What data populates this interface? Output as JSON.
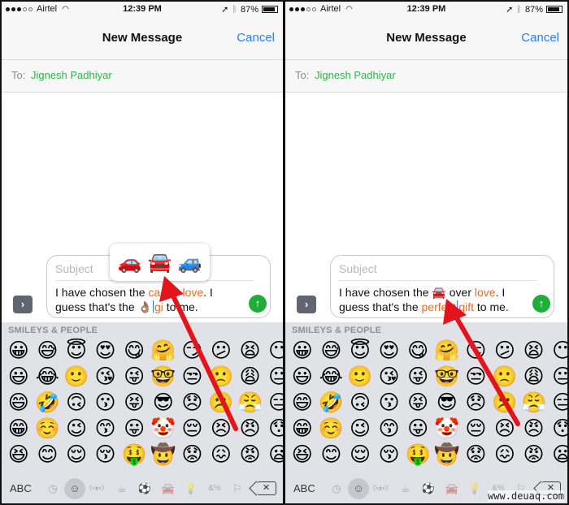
{
  "panels": [
    {
      "status": {
        "carrier": "Airtel",
        "time": "12:39 PM",
        "battery": "87%",
        "battery_level": 0.87
      },
      "nav": {
        "title": "New Message",
        "cancel": "Cancel"
      },
      "to": {
        "label": "To:",
        "recipient": "Jignesh Padhiyar"
      },
      "compose": {
        "subject_placeholder": "Subject",
        "line1": [
          "I have chosen the ",
          {
            "hl": "ca"
          },
          " ",
          "ver ",
          {
            "hl": "love"
          },
          ". I"
        ],
        "text_line1_a": "I have chosen the ",
        "text_line1_hl1": "ca",
        "text_line1_b": "ver ",
        "text_line1_hl2": "love",
        "text_line1_c": ". I",
        "text_line2_a": "guess that's the ",
        "text_line2_emoji": "👌🏽",
        "text_line2_hl": "gi",
        "text_line2_b": " to me."
      },
      "popup": {
        "options": [
          "🚗",
          "🚘",
          "🚙"
        ]
      }
    },
    {
      "status": {
        "carrier": "Airtel",
        "time": "12:39 PM",
        "battery": "87%",
        "battery_level": 0.87
      },
      "nav": {
        "title": "New Message",
        "cancel": "Cancel"
      },
      "to": {
        "label": "To:",
        "recipient": "Jignesh Padhiyar"
      },
      "compose": {
        "subject_placeholder": "Subject",
        "text_line1_a": "I have chosen the ",
        "text_line1_emoji": "🚘",
        "text_line1_b": " over ",
        "text_line1_hl": "love",
        "text_line1_c": ". I",
        "text_line2_a": "guess that's the ",
        "text_line2_hl1": "perfect",
        "text_line2_hl2": "gift",
        "text_line2_b": " to me."
      }
    }
  ],
  "keyboard": {
    "category_label": "SMILEYS & PEOPLE",
    "rows": [
      [
        "😀",
        "😅",
        "😇",
        "😍",
        "😋",
        "🤗",
        "😏",
        "😕",
        "😫",
        "😶"
      ],
      [
        "😃",
        "😂",
        "🙂",
        "😘",
        "😜",
        "🤓",
        "😒",
        "🙁",
        "😩",
        "😐"
      ],
      [
        "😄",
        "🤣",
        "🙃",
        "😗",
        "😝",
        "😎",
        "😞",
        "☹️",
        "😤",
        "😑"
      ],
      [
        "😁",
        "☺️",
        "😉",
        "😙",
        "😛",
        "🤡",
        "😔",
        "😣",
        "😠",
        "😯"
      ],
      [
        "😆",
        "😊",
        "😌",
        "😚",
        "🤑",
        "🤠",
        "😟",
        "😖",
        "😡",
        "😦"
      ]
    ],
    "abc_label": "ABC",
    "categories": [
      {
        "name": "recent",
        "glyph": "◷"
      },
      {
        "name": "smileys",
        "glyph": "☺",
        "active": true
      },
      {
        "name": "animals",
        "glyph": "ʕ•ᴥ•ʔ"
      },
      {
        "name": "food",
        "glyph": "☕"
      },
      {
        "name": "activity",
        "glyph": "⚽"
      },
      {
        "name": "travel",
        "glyph": "🚘"
      },
      {
        "name": "objects",
        "glyph": "💡"
      },
      {
        "name": "symbols",
        "glyph": "&%"
      },
      {
        "name": "flags",
        "glyph": "⚐"
      }
    ],
    "delete_glyph": "✕"
  },
  "colors": {
    "accent_blue": "#2e7cf6",
    "recipient_green": "#2fb448",
    "highlight_orange": "#ec6b1f",
    "send_green": "#1fae3a",
    "arrow_red": "#e3141b"
  },
  "watermark": "www.deuaq.com"
}
